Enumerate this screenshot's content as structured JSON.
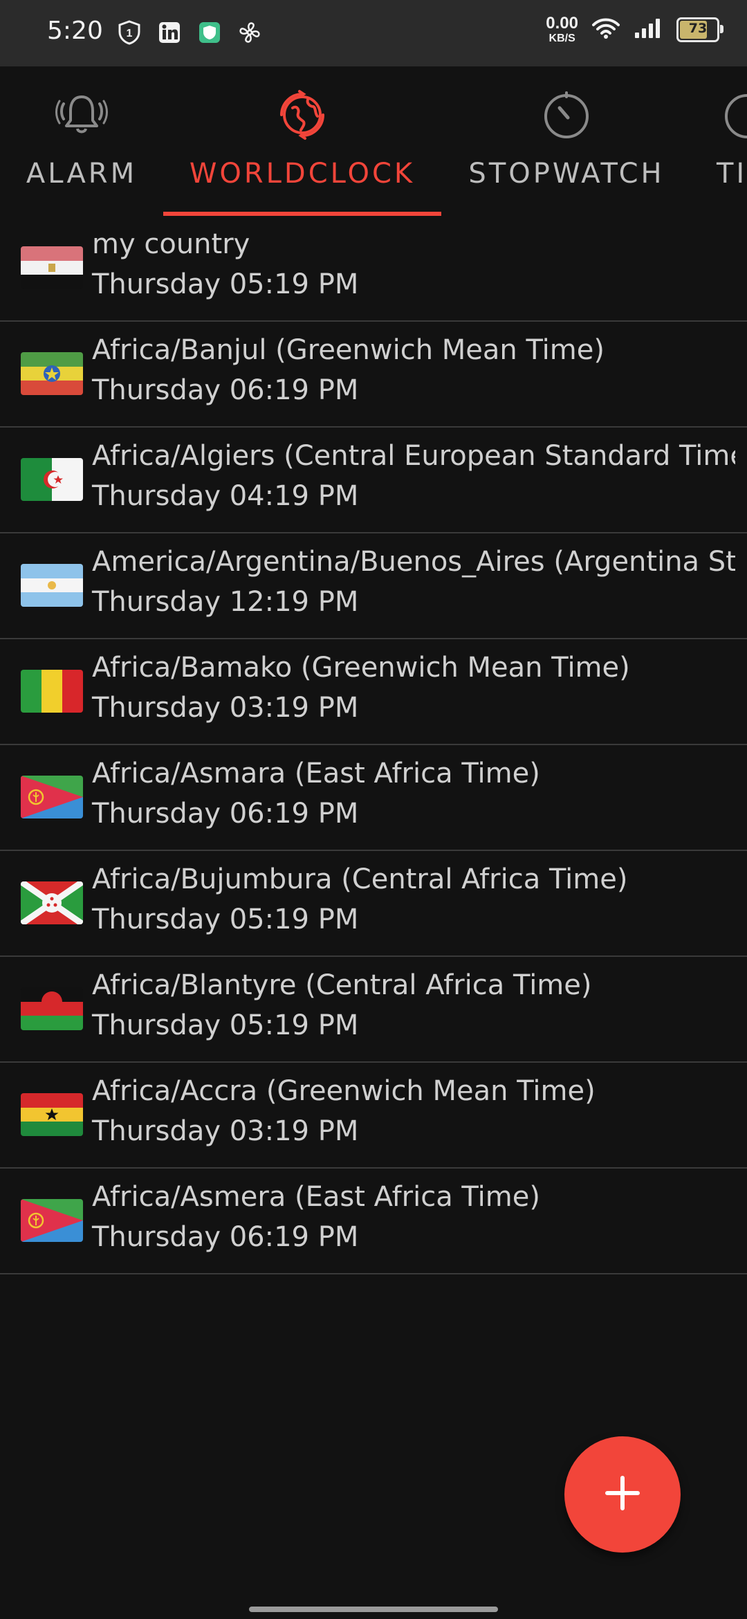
{
  "status_bar": {
    "time": "5:20",
    "net_speed_value": "0.00",
    "net_speed_unit": "KB/S",
    "battery_level": "73",
    "icons": [
      "shield-1-icon",
      "linkedin-icon",
      "security-app-icon",
      "fan-icon",
      "wifi-icon",
      "signal-icon",
      "battery-icon"
    ]
  },
  "tabs": [
    {
      "label": "ALARM",
      "icon": "alarm-bell-icon",
      "active": false
    },
    {
      "label": "WORLDCLOCK",
      "icon": "worldclock-globe-icon",
      "active": true
    },
    {
      "label": "STOPWATCH",
      "icon": "stopwatch-icon",
      "active": false
    },
    {
      "label": "TI",
      "icon": "timer-icon",
      "active": false
    }
  ],
  "clocks": [
    {
      "name": "my country",
      "time": "Thursday 05:19 PM",
      "flag": "egypt-flag-icon"
    },
    {
      "name": "Africa/Banjul (Greenwich Mean Time)",
      "time": "Thursday 06:19 PM",
      "flag": "ethiopia-flag-icon"
    },
    {
      "name": "Africa/Algiers (Central European Standard Time)",
      "time": "Thursday 04:19 PM",
      "flag": "algeria-flag-icon"
    },
    {
      "name": "America/Argentina/Buenos_Aires (Argentina St. .",
      "time": "Thursday 12:19 PM",
      "flag": "argentina-flag-icon"
    },
    {
      "name": "Africa/Bamako (Greenwich Mean Time)",
      "time": "Thursday 03:19 PM",
      "flag": "mali-flag-icon"
    },
    {
      "name": "Africa/Asmara (East Africa Time)",
      "time": "Thursday 06:19 PM",
      "flag": "eritrea-flag-icon"
    },
    {
      "name": "Africa/Bujumbura (Central Africa Time)",
      "time": "Thursday 05:19 PM",
      "flag": "burundi-flag-icon"
    },
    {
      "name": "Africa/Blantyre (Central Africa Time)",
      "time": "Thursday 05:19 PM",
      "flag": "malawi-flag-icon"
    },
    {
      "name": "Africa/Accra (Greenwich Mean Time)",
      "time": "Thursday 03:19 PM",
      "flag": "ghana-flag-icon"
    },
    {
      "name": "Africa/Asmera (East Africa Time)",
      "time": "Thursday 06:19 PM",
      "flag": "eritrea-flag-icon"
    }
  ],
  "fab": {
    "icon": "plus-icon"
  },
  "colors": {
    "accent": "#f2453a",
    "background": "#121212",
    "status_bar": "#2b2b2b",
    "divider": "#3a3a3a"
  }
}
